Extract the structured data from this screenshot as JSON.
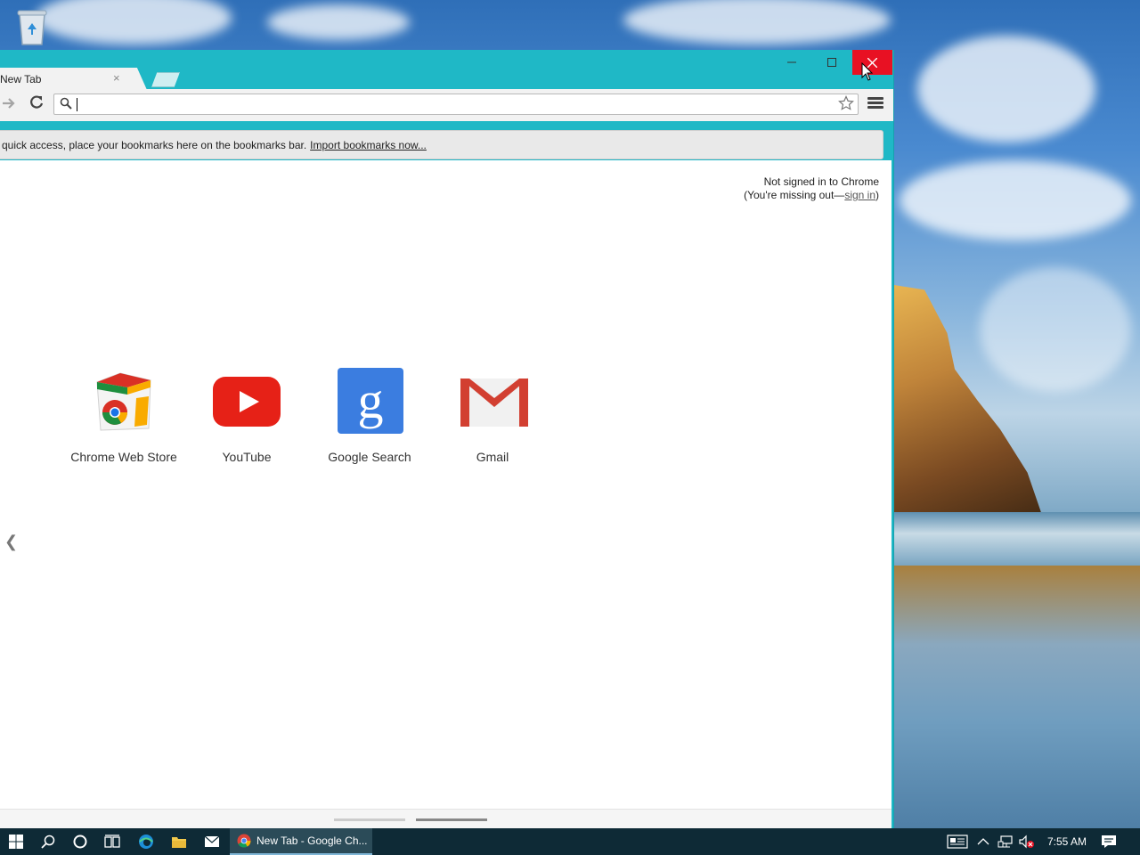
{
  "browser": {
    "tab_title": "New Tab",
    "tab_close_glyph": "×",
    "omnibox_value": "",
    "bookmarks_bar_text": "quick access, place your bookmarks here on the bookmarks bar.",
    "bookmarks_bar_link": "Import bookmarks now...",
    "signin_line1": "Not signed in to Chrome",
    "signin_line2_prefix": "(You're missing out—",
    "signin_link": "sign in",
    "signin_line2_suffix": ")",
    "prev_arrow": "❮",
    "apps": [
      {
        "label": "Chrome Web Store",
        "icon": "chrome-web-store-icon"
      },
      {
        "label": "YouTube",
        "icon": "youtube-icon"
      },
      {
        "label": "Google Search",
        "icon": "google-search-icon"
      },
      {
        "label": "Gmail",
        "icon": "gmail-icon"
      }
    ],
    "window_controls": {
      "minimize": "—",
      "maximize": "☐",
      "close": "✕"
    }
  },
  "taskbar": {
    "chrome_item_label": "New Tab - Google Ch...",
    "clock": "7:55 AM",
    "icons": [
      "windows-start-icon",
      "search-icon",
      "cortana-icon",
      "task-view-icon",
      "edge-icon",
      "file-explorer-icon",
      "mail-icon",
      "chrome-icon"
    ]
  },
  "colors": {
    "window_frame": "#1fb8c6",
    "close_button": "#e81123",
    "taskbar": "#0e2a36"
  }
}
